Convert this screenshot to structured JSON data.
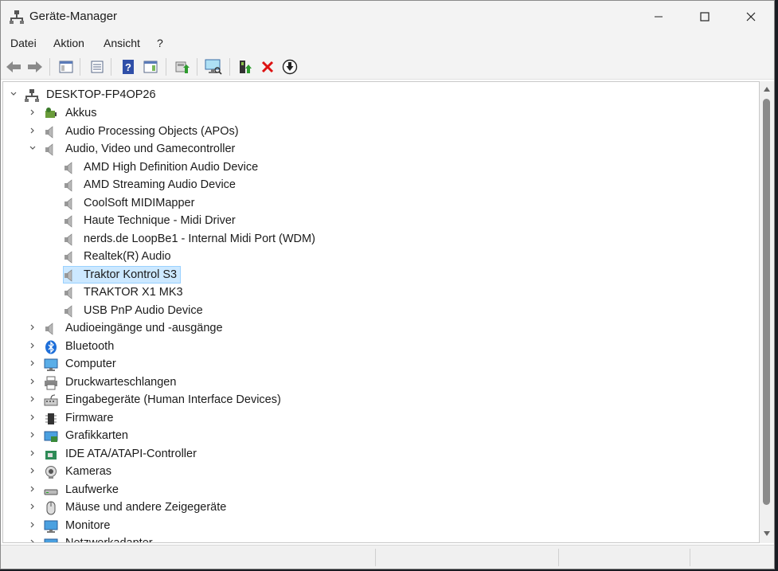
{
  "window": {
    "title": "Geräte-Manager"
  },
  "menu": [
    "Datei",
    "Aktion",
    "Ansicht",
    "?"
  ],
  "toolbar": {
    "buttons": [
      "back-icon",
      "forward-icon",
      "properties-view-icon",
      "show-hide-console-tree-icon",
      "help-icon",
      "action-pane-icon",
      "update-driver-icon",
      "scan-hardware-icon",
      "enable-device-icon",
      "uninstall-icon",
      "download-icon"
    ]
  },
  "tree": {
    "root": "DESKTOP-FP4OP26",
    "categories": [
      {
        "label": "Akkus",
        "icon": "battery-icon"
      },
      {
        "label": "Audio Processing Objects (APOs)",
        "icon": "speaker-icon"
      },
      {
        "label": "Audio, Video und Gamecontroller",
        "icon": "speaker-icon",
        "expanded": true,
        "children": [
          "AMD High Definition Audio Device",
          "AMD Streaming Audio Device",
          "CoolSoft MIDIMapper",
          "Haute Technique - Midi Driver",
          "nerds.de LoopBe1 - Internal Midi Port (WDM)",
          "Realtek(R) Audio",
          "Traktor Kontrol S3",
          "TRAKTOR X1 MK3",
          "USB PnP Audio Device"
        ],
        "selected": "Traktor Kontrol S3"
      },
      {
        "label": "Audioeingänge und -ausgänge",
        "icon": "speaker-icon"
      },
      {
        "label": "Bluetooth",
        "icon": "bluetooth-icon"
      },
      {
        "label": "Computer",
        "icon": "computer-icon"
      },
      {
        "label": "Druckwarteschlangen",
        "icon": "printer-icon"
      },
      {
        "label": "Eingabegeräte (Human Interface Devices)",
        "icon": "hid-icon"
      },
      {
        "label": "Firmware",
        "icon": "firmware-icon"
      },
      {
        "label": "Grafikkarten",
        "icon": "display-adapter-icon"
      },
      {
        "label": "IDE ATA/ATAPI-Controller",
        "icon": "ide-controller-icon"
      },
      {
        "label": "Kameras",
        "icon": "camera-icon"
      },
      {
        "label": "Laufwerke",
        "icon": "drive-icon"
      },
      {
        "label": "Mäuse und andere Zeigegeräte",
        "icon": "mouse-icon"
      },
      {
        "label": "Monitore",
        "icon": "monitor-icon"
      },
      {
        "label": "Netzwerkadapter",
        "icon": "network-adapter-icon"
      }
    ]
  },
  "colors": {
    "selection": "#cce8ff",
    "selection_border": "#99d1ff",
    "scroll_thumb": "#8a8a8a"
  }
}
